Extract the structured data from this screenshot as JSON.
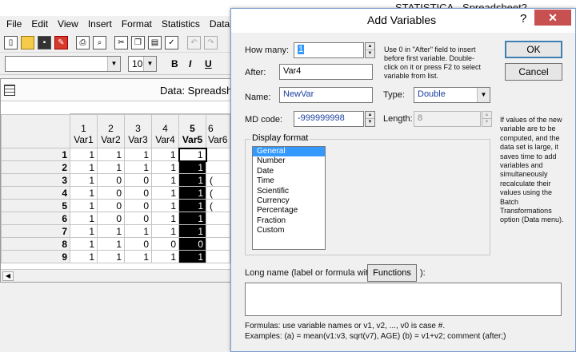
{
  "app": {
    "title": "STATISTICA - Spreadsheet2"
  },
  "menu": [
    "File",
    "Edit",
    "View",
    "Insert",
    "Format",
    "Statistics",
    "Data Mi"
  ],
  "toolbar": {
    "font_size": "10",
    "bold": "B",
    "italic": "I",
    "underline": "U"
  },
  "spreadsheet": {
    "title": "Data: Spreadsh",
    "columns": [
      {
        "num": "1",
        "name": "Var1"
      },
      {
        "num": "2",
        "name": "Var2"
      },
      {
        "num": "3",
        "name": "Var3"
      },
      {
        "num": "4",
        "name": "Var4"
      },
      {
        "num": "5",
        "name": "Var5"
      },
      {
        "num": "6",
        "name": "Var6"
      }
    ],
    "rows": [
      {
        "id": "1",
        "cells": [
          "1",
          "1",
          "1",
          "1",
          "1",
          ""
        ]
      },
      {
        "id": "2",
        "cells": [
          "1",
          "1",
          "1",
          "1",
          "1",
          ""
        ]
      },
      {
        "id": "3",
        "cells": [
          "1",
          "0",
          "0",
          "1",
          "1",
          "("
        ]
      },
      {
        "id": "4",
        "cells": [
          "1",
          "0",
          "0",
          "1",
          "1",
          "("
        ]
      },
      {
        "id": "5",
        "cells": [
          "1",
          "0",
          "0",
          "1",
          "1",
          "("
        ]
      },
      {
        "id": "6",
        "cells": [
          "1",
          "0",
          "0",
          "1",
          "1",
          ""
        ]
      },
      {
        "id": "7",
        "cells": [
          "1",
          "1",
          "1",
          "1",
          "1",
          ""
        ]
      },
      {
        "id": "8",
        "cells": [
          "1",
          "1",
          "0",
          "0",
          "0",
          ""
        ]
      },
      {
        "id": "9",
        "cells": [
          "1",
          "1",
          "1",
          "1",
          "1",
          ""
        ]
      }
    ]
  },
  "dialog": {
    "title": "Add Variables",
    "help": "?",
    "close": "✕",
    "how_many_label": "How many:",
    "how_many_value": "1",
    "after_label": "After:",
    "after_value": "Var4",
    "name_label": "Name:",
    "name_value": "NewVar",
    "md_code_label": "MD code:",
    "md_code_value": "-999999998",
    "type_label": "Type:",
    "type_value": "Double",
    "length_label": "Length:",
    "length_value": "8",
    "hint": "Use 0 in \"After\" field to insert before first variable. Double-click on it or press F2 to select variable from list.",
    "ok": "OK",
    "cancel": "Cancel",
    "display_format_label": "Display format",
    "formats": [
      "General",
      "Number",
      "Date",
      "Time",
      "Scientific",
      "Currency",
      "Percentage",
      "Fraction",
      "Custom"
    ],
    "selected_format": "General",
    "side_note": "If values of the new variable are to be computed, and the data set is large, it saves time to add variables and simultaneously recalculate their values using the Batch Transformations option (Data menu).",
    "long_name_label": "Long name (label or formula with",
    "functions_button": "Functions",
    "long_name_suffix": "):",
    "long_name_value": "",
    "footer_line1": "Formulas: use variable names or v1, v2, ..., v0 is case #.",
    "footer_line2": "Examples:   (a) = mean(v1:v3, sqrt(v7), AGE)   (b) = v1+v2; comment (after;)"
  }
}
